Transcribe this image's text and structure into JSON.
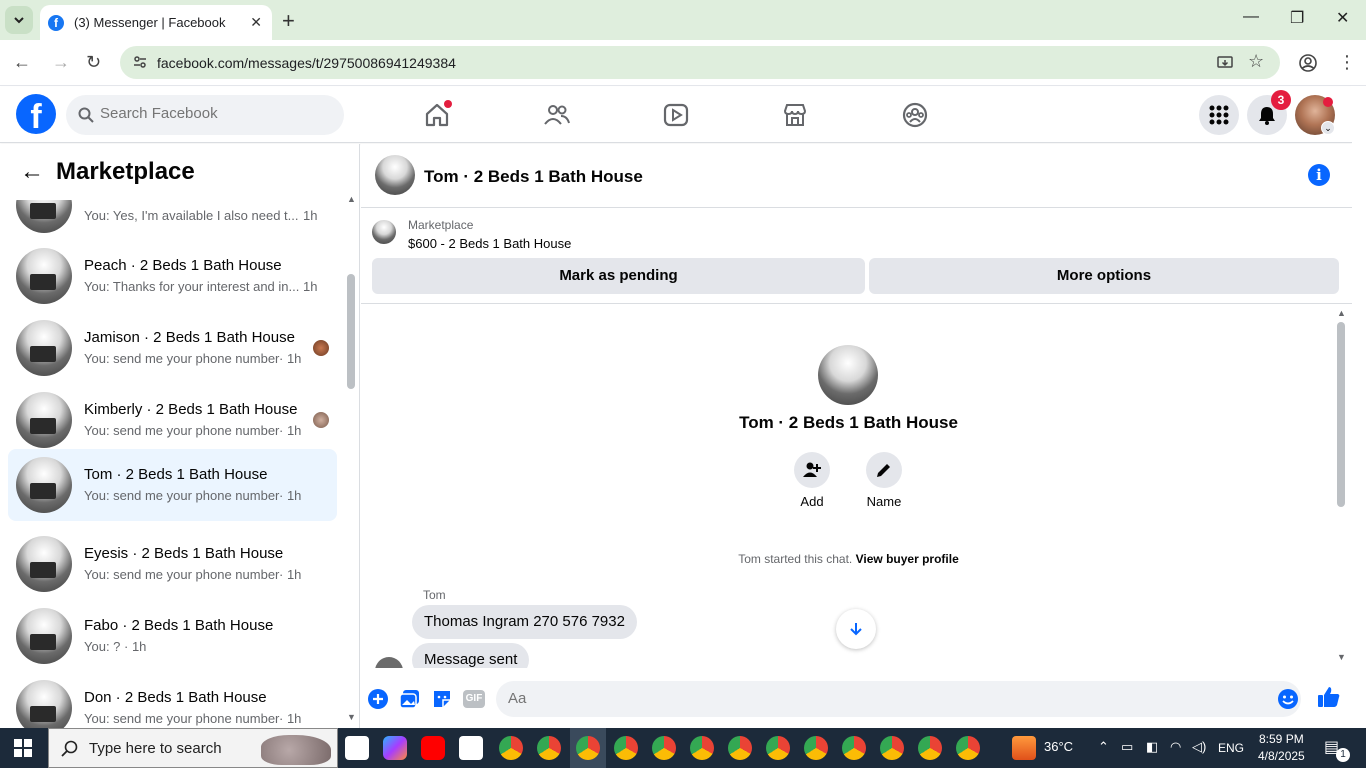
{
  "browser": {
    "tab_title": "(3) Messenger | Facebook",
    "url": "facebook.com/messages/t/29750086941249384"
  },
  "fb": {
    "logo_letter": "f",
    "search_placeholder": "Search Facebook",
    "notification_count": "3"
  },
  "left": {
    "title": "Marketplace",
    "conversations": [
      {
        "name": "",
        "snippet": "You: Yes, I'm available I also need t...",
        "time": "1h"
      },
      {
        "name": "Peach · 2 Beds 1 Bath House",
        "snippet": "You: Thanks for your interest and in...",
        "time": "1h"
      },
      {
        "name": "Jamison · 2 Beds 1 Bath House",
        "snippet": "You: send me your phone number",
        "time": "· 1h"
      },
      {
        "name": "Kimberly · 2 Beds 1 Bath House",
        "snippet": "You: send me your phone number",
        "time": "· 1h"
      },
      {
        "name": "Tom · 2 Beds 1 Bath House",
        "snippet": "You: send me your phone number",
        "time": "· 1h"
      },
      {
        "name": "Eyesis · 2 Beds 1 Bath House",
        "snippet": "You: send me your phone number",
        "time": "· 1h"
      },
      {
        "name": "Fabo · 2 Beds 1 Bath House",
        "snippet": "You: ? · 1h",
        "time": ""
      },
      {
        "name": "Don · 2 Beds 1 Bath House",
        "snippet": "You: send me your phone number",
        "time": "· 1h"
      }
    ]
  },
  "chat": {
    "title": "Tom · 2 Beds 1 Bath House",
    "marketplace_label": "Marketplace",
    "listing": "$600 - 2 Beds 1 Bath House",
    "mark_pending": "Mark as pending",
    "more_options": "More options",
    "profile_name": "Tom · 2 Beds 1 Bath House",
    "add_label": "Add",
    "name_label": "Name",
    "started_text": "Tom started this chat.",
    "view_buyer": "View buyer profile",
    "sender": "Tom",
    "message1": "Thomas Ingram 270 576 7932",
    "message2": "Message sent",
    "composer_placeholder": "Aa"
  },
  "taskbar": {
    "search_placeholder": "Type here to search",
    "temperature": "36°C",
    "language": "ENG",
    "time": "8:59 PM",
    "date": "4/8/2025",
    "notif_count": "1"
  },
  "colors": {
    "fb_blue": "#0866ff",
    "active_conv": "#ebf5ff",
    "badge_red": "#e41e3f"
  }
}
